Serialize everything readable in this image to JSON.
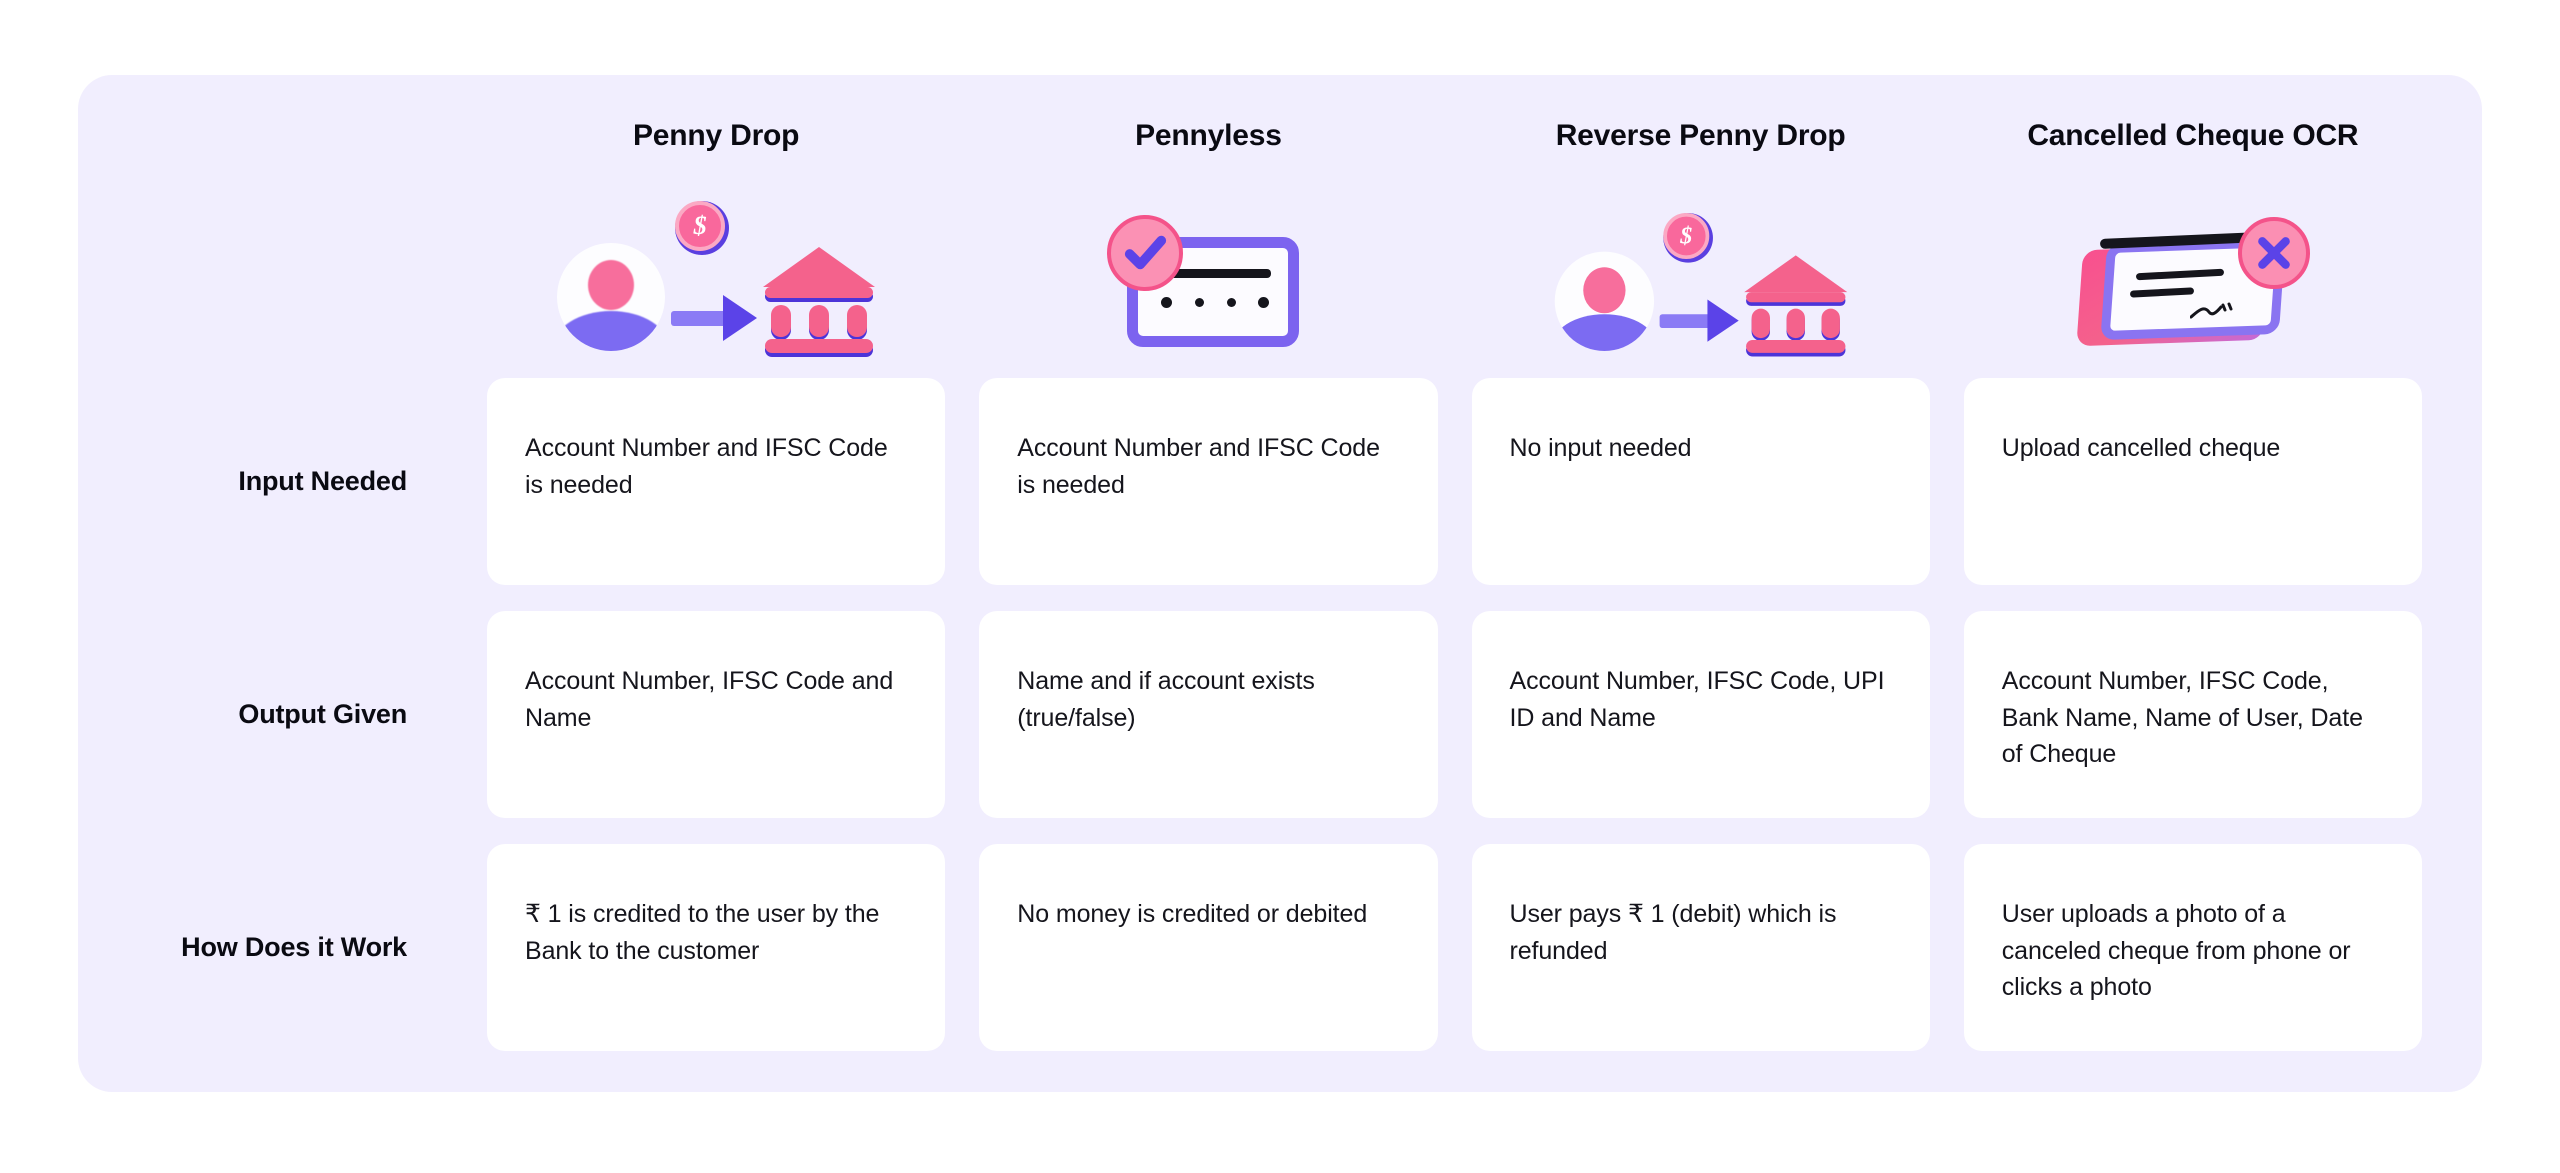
{
  "panel": {
    "background_color": "#f1eefe",
    "card_color": "#ffffff"
  },
  "columns": [
    {
      "id": "penny-drop",
      "title": "Penny Drop",
      "illustration": "person-coin-bank-flow-icon"
    },
    {
      "id": "pennyless",
      "title": "Pennyless",
      "illustration": "checkmark-card-icon"
    },
    {
      "id": "reverse-penny-drop",
      "title": "Reverse Penny Drop",
      "illustration": "person-coin-bank-flow-icon"
    },
    {
      "id": "cancelled-cheque-ocr",
      "title": "Cancelled Cheque OCR",
      "illustration": "cancelled-cheque-icon"
    }
  ],
  "rows": [
    {
      "id": "input-needed",
      "label": "Input Needed",
      "cells": [
        "Account Number and IFSC Code is needed",
        "Account Number and IFSC Code is needed",
        "No input needed",
        "Upload cancelled cheque"
      ]
    },
    {
      "id": "output-given",
      "label": "Output Given",
      "cells": [
        "Account Number, IFSC Code and Name",
        "Name and if account exists (true/false)",
        "Account Number, IFSC Code, UPI ID and Name",
        "Account Number, IFSC Code, Bank Name, Name of User, Date of Cheque"
      ]
    },
    {
      "id": "how-does-it-work",
      "label": "How Does it Work",
      "cells": [
        "₹ 1 is credited to the user by the Bank to the customer",
        "No money is credited or debited",
        "User pays ₹ 1 (debit) which is refunded",
        "User uploads a photo of a canceled cheque from phone or clicks a photo"
      ]
    }
  ],
  "illustration_labels": {
    "coin_symbol": "$",
    "avatar": "user-avatar-icon",
    "arrow": "right-arrow-icon",
    "bank": "bank-building-icon",
    "check_badge": "check-circle-icon",
    "x_badge": "x-circle-icon"
  },
  "colors": {
    "panel_bg": "#f1eefe",
    "card_bg": "#ffffff",
    "text": "#15151c",
    "heading": "#0a0a12",
    "accent_pink": "#f4628c",
    "accent_purple": "#7c6bf2",
    "accent_magenta": "#f4538a"
  }
}
